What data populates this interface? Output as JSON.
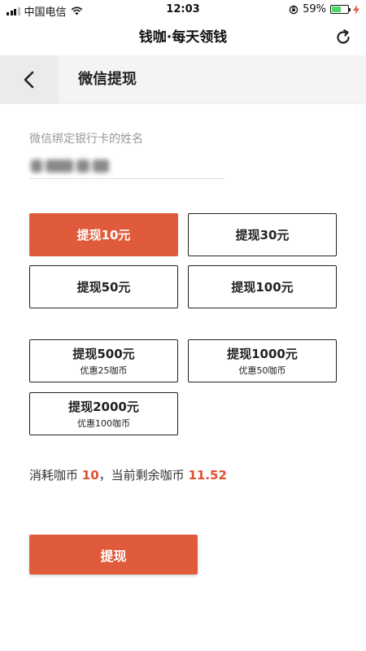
{
  "status_bar": {
    "carrier": "中国电信",
    "time": "12:03",
    "battery_percent": "59%",
    "battery_level": 0.59,
    "icons": [
      "signal-icon",
      "wifi-icon",
      "orientation-lock-icon",
      "battery-icon",
      "charging-icon"
    ]
  },
  "app_header": {
    "title": "钱咖·每天领钱",
    "refresh_icon": "refresh-icon"
  },
  "sub_header": {
    "back_icon": "chevron-left-icon",
    "title": "微信提现"
  },
  "form": {
    "name_label": "微信绑定银行卡的姓名",
    "name_value": ""
  },
  "options": [
    {
      "label": "提现10元",
      "sub": "",
      "selected": true
    },
    {
      "label": "提现30元",
      "sub": "",
      "selected": false
    },
    {
      "label": "提现50元",
      "sub": "",
      "selected": false
    },
    {
      "label": "提现100元",
      "sub": "",
      "selected": false
    },
    {
      "label": "提现500元",
      "sub": "优惠25咖币",
      "selected": false
    },
    {
      "label": "提现1000元",
      "sub": "优惠50咖币",
      "selected": false
    },
    {
      "label": "提现2000元",
      "sub": "优惠100咖币",
      "selected": false
    }
  ],
  "summary": {
    "consume_prefix": "消耗咖币",
    "consume_value": "10",
    "separator": "，当前剩余咖币",
    "balance_value": "11.52"
  },
  "submit_label": "提现",
  "colors": {
    "accent": "#e05a3c",
    "highlight_text": "#e0512f",
    "battery_green": "#4cd964"
  }
}
